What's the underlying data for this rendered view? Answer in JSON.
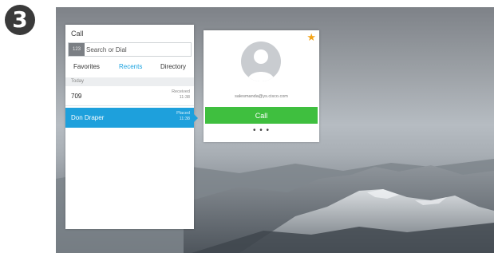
{
  "step": {
    "number": "3"
  },
  "call_panel": {
    "title": "Call",
    "search": {
      "badge": "123",
      "placeholder": "Search or Dial"
    },
    "tabs": [
      {
        "label": "Favorites",
        "active": false
      },
      {
        "label": "Recents",
        "active": true
      },
      {
        "label": "Directory",
        "active": false
      }
    ],
    "section_label": "Today",
    "rows": [
      {
        "name": "709",
        "status": "Received",
        "time": "11:38",
        "selected": false
      },
      {
        "name": "Don Draper",
        "status": "Placed",
        "time": "11:38",
        "selected": true
      }
    ]
  },
  "contact_card": {
    "favorite_icon": "star-icon",
    "avatar_icon": "person-icon",
    "email": "salesmanda@ys.cisco.com",
    "call_label": "Call",
    "more_label": "• • •"
  },
  "colors": {
    "accent": "#1ea0dc",
    "call_green": "#3fbf3f",
    "star": "#f4a418"
  }
}
